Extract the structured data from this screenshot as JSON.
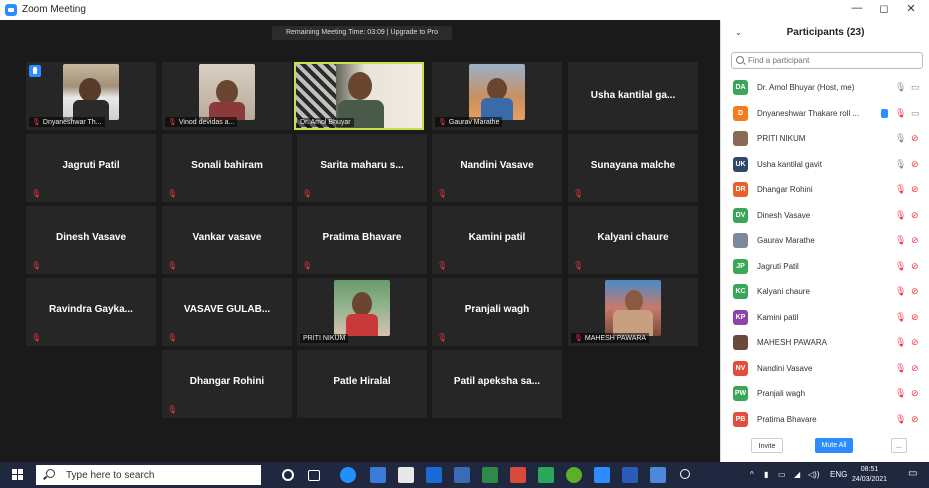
{
  "window": {
    "title": "Zoom Meeting",
    "minimize": "—",
    "restore": "◻",
    "close": "✕"
  },
  "banner": "Remaining Meeting Time: 03:09 | Upgrade to Pro",
  "tiles": [
    {
      "label": "Dnyaneshwar Th..."
    },
    {
      "label": "Vinod devidas a..."
    },
    {
      "label": "Dr. Amol Bhuyar"
    },
    {
      "label": "Gaurav Marathe"
    },
    {
      "name": "Usha kantilal ga..."
    },
    {
      "name": "Jagruti Patil"
    },
    {
      "name": "Sonali bahiram"
    },
    {
      "name": "Sarita maharu s..."
    },
    {
      "name": "Nandini Vasave"
    },
    {
      "name": "Sunayana malche"
    },
    {
      "name": "Dinesh Vasave"
    },
    {
      "name": "Vankar vasave"
    },
    {
      "name": "Pratima Bhavare"
    },
    {
      "name": "Kamini patil"
    },
    {
      "name": "Kalyani chaure"
    },
    {
      "name": "Ravindra Gayka..."
    },
    {
      "name": "VASAVE GULAB..."
    },
    {
      "label": "PRITI NIKUM"
    },
    {
      "name": "Pranjali wagh"
    },
    {
      "label": "MAHESH PAWARA"
    },
    {
      "name": "Dhangar Rohini"
    },
    {
      "name": "Patle Hiralal"
    },
    {
      "name": "Patil apeksha sa..."
    }
  ],
  "panel": {
    "title": "Participants (23)",
    "search_placeholder": "Find a participant",
    "participants": [
      {
        "initials": "DA",
        "color": "#3aa657",
        "name": "Dr. Amol Bhuyar (Host, me)"
      },
      {
        "initials": "D",
        "color": "#f47b20",
        "name": "Dnyaneshwar Thakare roll ..."
      },
      {
        "initials": "",
        "color": "#8a6a55",
        "name": "PRITI NIKUM"
      },
      {
        "initials": "UK",
        "color": "#2d4a6a",
        "name": "Usha kantilal gavit"
      },
      {
        "initials": "DR",
        "color": "#e8602c",
        "name": "Dhangar Rohini"
      },
      {
        "initials": "DV",
        "color": "#3aa657",
        "name": "Dinesh Vasave"
      },
      {
        "initials": "",
        "color": "#7a8a9a",
        "name": "Gaurav Marathe"
      },
      {
        "initials": "JP",
        "color": "#3aa657",
        "name": "Jagruti Patil"
      },
      {
        "initials": "KC",
        "color": "#3aa657",
        "name": "Kalyani chaure"
      },
      {
        "initials": "KP",
        "color": "#8e44ad",
        "name": "Kamini patil"
      },
      {
        "initials": "",
        "color": "#6a4a3a",
        "name": "MAHESH PAWARA"
      },
      {
        "initials": "NV",
        "color": "#e34d3c",
        "name": "Nandini Vasave"
      },
      {
        "initials": "PW",
        "color": "#3aa657",
        "name": "Pranjali wagh"
      },
      {
        "initials": "PB",
        "color": "#e34d3c",
        "name": "Pratima Bhavare"
      }
    ],
    "invite": "Invite",
    "mute_all": "Mute All",
    "more": "..."
  },
  "taskbar": {
    "search_text": "Type here to search",
    "lang": "ENG",
    "time": "08:51",
    "date": "24/03/2021"
  }
}
